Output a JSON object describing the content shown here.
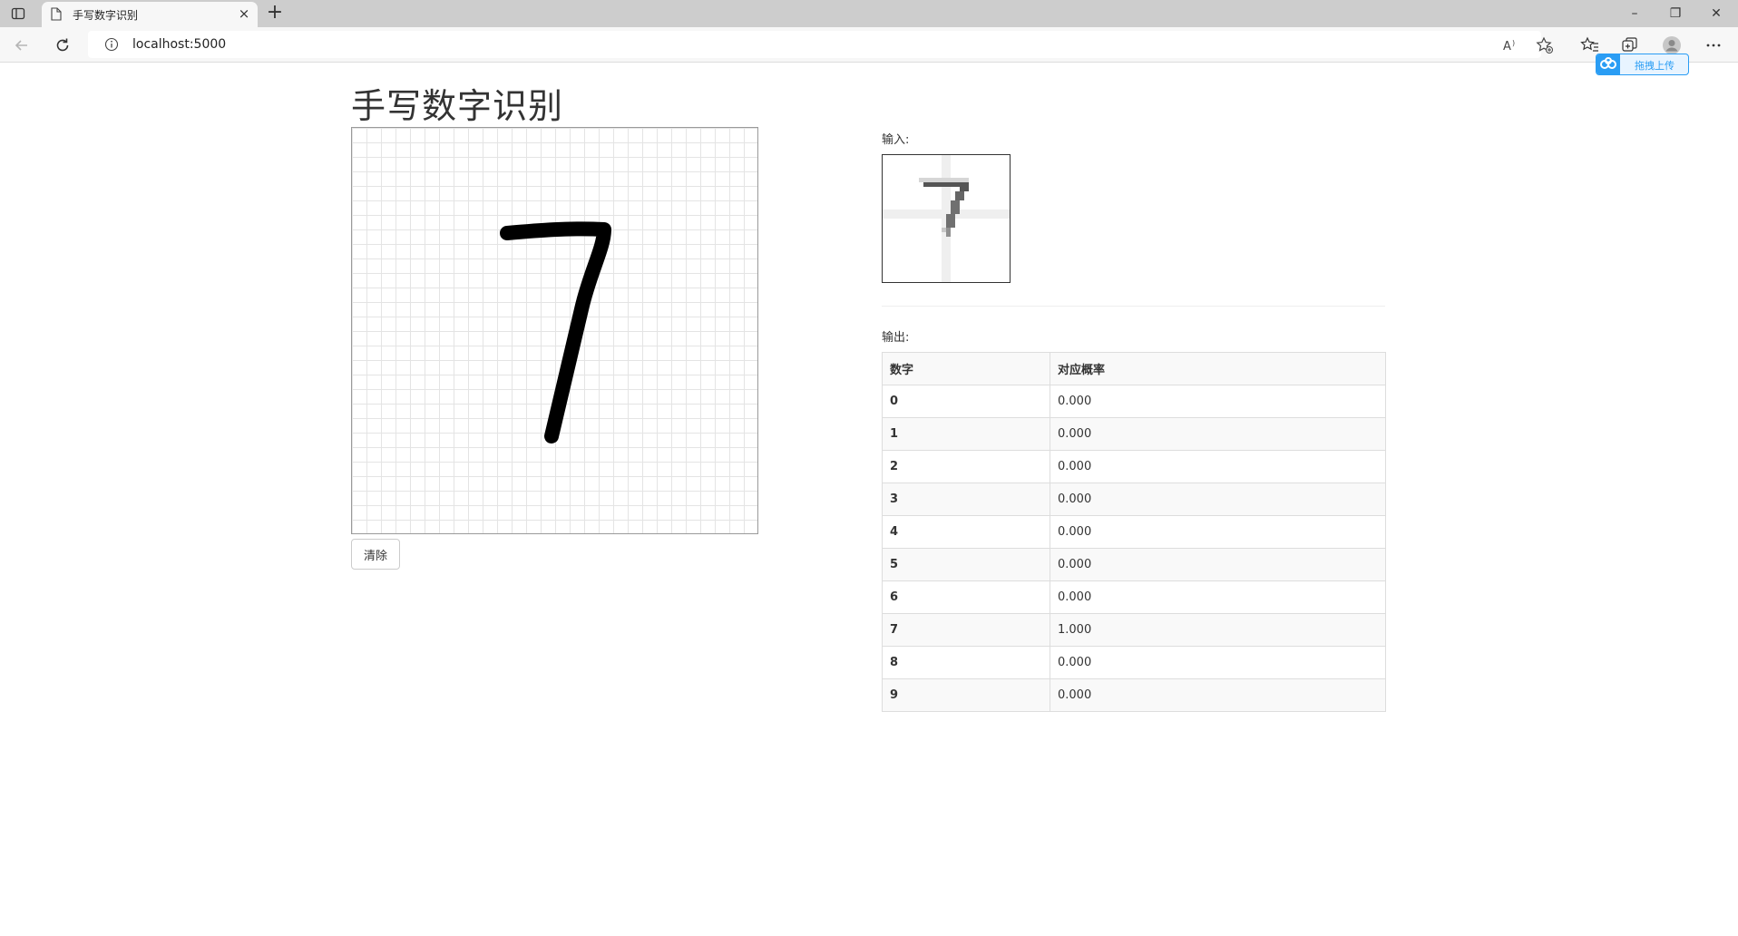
{
  "browser": {
    "tab_title": "手写数字识别",
    "tab_close": "×",
    "new_tab": "+",
    "url": "localhost:5000",
    "window_controls": {
      "minimize": "–",
      "restore": "❐",
      "close": "✕"
    },
    "upload_widget_label": "拖拽上传"
  },
  "page": {
    "title": "手写数字识别",
    "clear_button": "清除",
    "input_label": "输入:",
    "output_label": "输出:",
    "drawn_digit": "7"
  },
  "results": {
    "headers": [
      "数字",
      "对应概率"
    ],
    "rows": [
      {
        "digit": "0",
        "prob": "0.000"
      },
      {
        "digit": "1",
        "prob": "0.000"
      },
      {
        "digit": "2",
        "prob": "0.000"
      },
      {
        "digit": "3",
        "prob": "0.000"
      },
      {
        "digit": "4",
        "prob": "0.000"
      },
      {
        "digit": "5",
        "prob": "0.000"
      },
      {
        "digit": "6",
        "prob": "0.000"
      },
      {
        "digit": "7",
        "prob": "1.000"
      },
      {
        "digit": "8",
        "prob": "0.000"
      },
      {
        "digit": "9",
        "prob": "0.000"
      }
    ]
  },
  "icons": {
    "tab_actions": "tab-actions-icon",
    "page": "page-icon",
    "back": "back-arrow-icon",
    "refresh": "refresh-icon",
    "site_info": "info-icon",
    "read_aloud": "read-aloud-icon",
    "add_favorite": "add-favorite-icon",
    "favorites": "favorites-icon",
    "collections": "collections-icon",
    "profile": "profile-icon",
    "menu": "more-icon"
  },
  "colors": {
    "accent": "#2a9df4",
    "stroke": "#000000"
  }
}
